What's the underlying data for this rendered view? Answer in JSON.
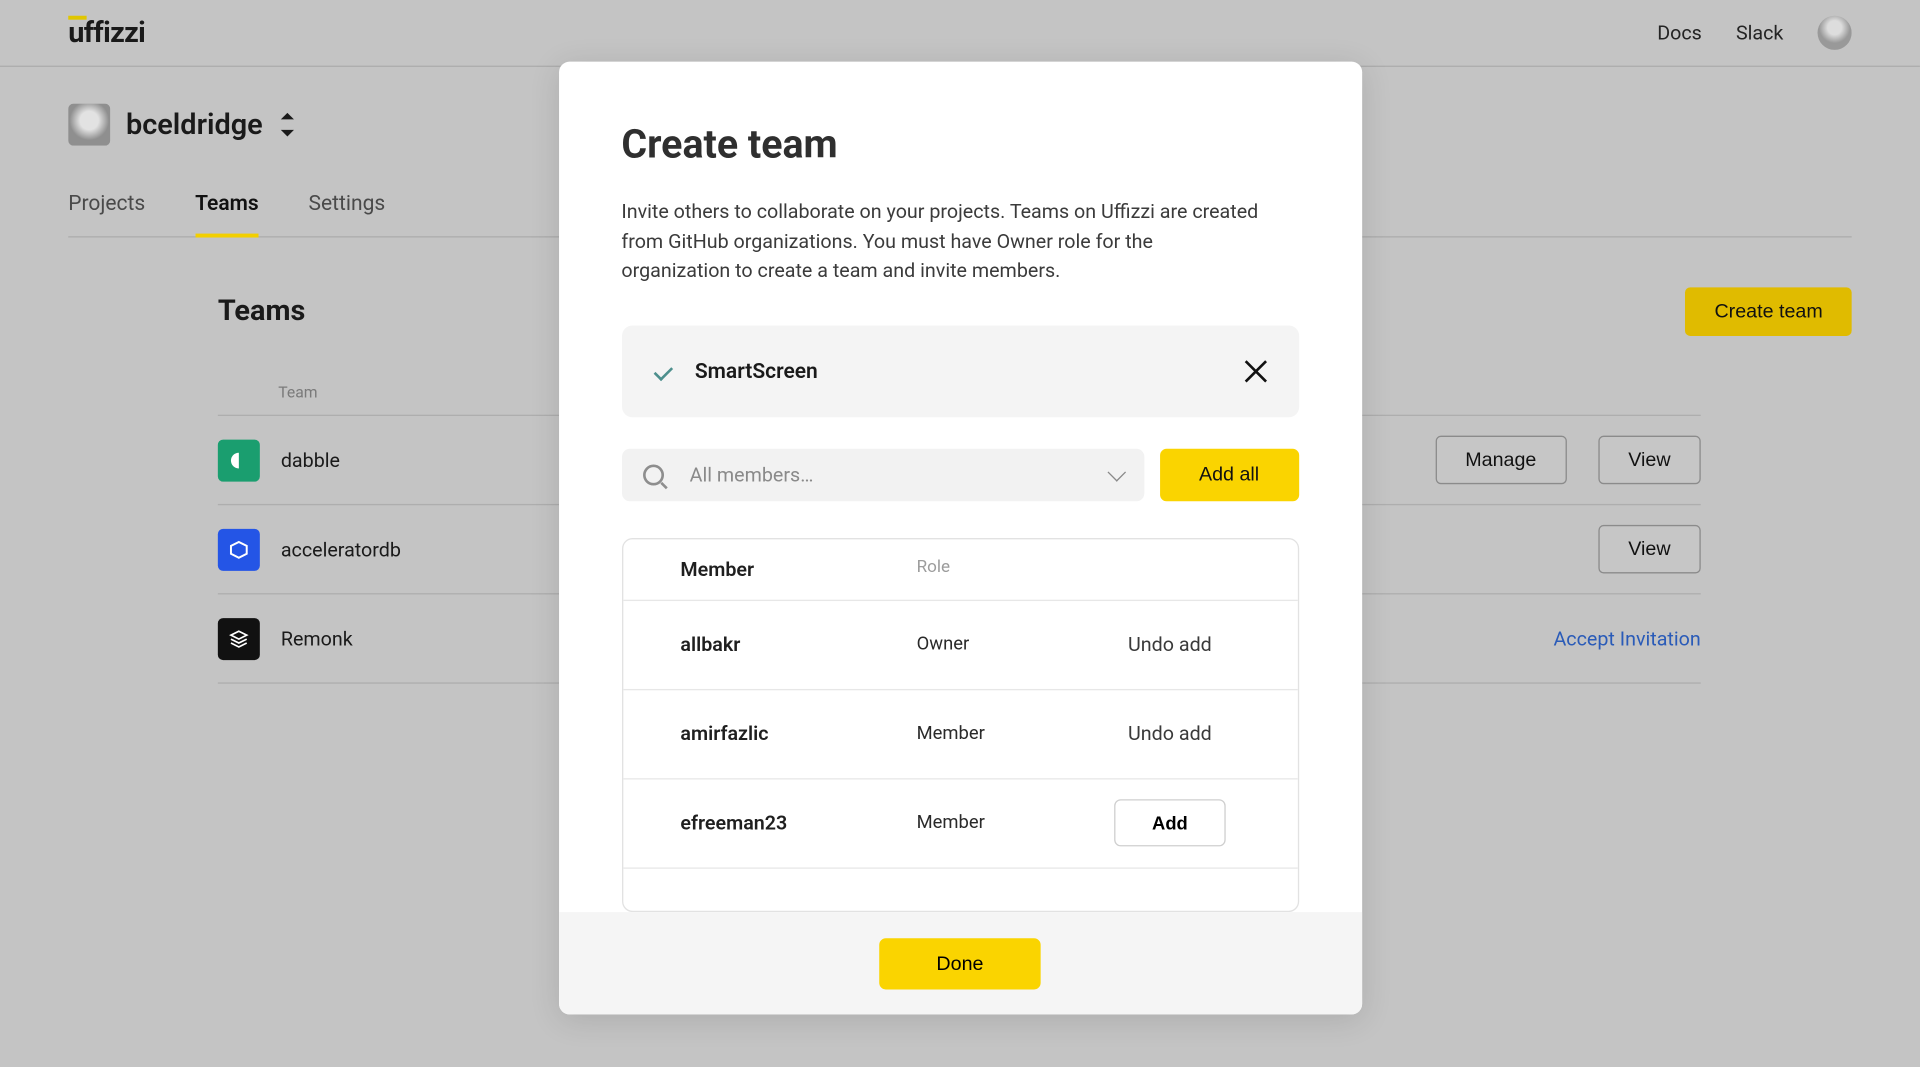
{
  "header": {
    "logo": "uffizzi",
    "links": {
      "docs": "Docs",
      "slack": "Slack"
    }
  },
  "subheader": {
    "username": "bceldridge"
  },
  "tabs": {
    "projects": "Projects",
    "teams": "Teams",
    "settings": "Settings"
  },
  "teamsPage": {
    "title": "Teams",
    "createButton": "Create team",
    "columnHeader": "Team",
    "rows": [
      {
        "name": "dabble",
        "iconBg": "#1a9e6f",
        "glyph": "◖",
        "actions": {
          "manage": "Manage",
          "view": "View"
        }
      },
      {
        "name": "acceleratordb",
        "iconBg": "#2455e6",
        "glyph": "⬚",
        "actions": {
          "view": "View"
        }
      },
      {
        "name": "Remonk",
        "iconBg": "#111111",
        "glyph": "≋",
        "actions": {
          "accept": "Accept Invitation"
        }
      }
    ]
  },
  "modal": {
    "title": "Create team",
    "description": "Invite others to collaborate on your projects. Teams on Uffizzi are created from GitHub organizations. You must have Owner role for the organization to create a team and invite members.",
    "selectedTeam": "SmartScreen",
    "searchPlaceholder": "All members…",
    "addAll": "Add all",
    "columns": {
      "member": "Member",
      "role": "Role"
    },
    "members": [
      {
        "name": "allbakr",
        "role": "Owner",
        "action": "undo"
      },
      {
        "name": "amirfazlic",
        "role": "Member",
        "action": "undo"
      },
      {
        "name": "efreeman23",
        "role": "Member",
        "action": "add"
      }
    ],
    "undoLabel": "Undo add",
    "addLabel": "Add",
    "done": "Done"
  }
}
